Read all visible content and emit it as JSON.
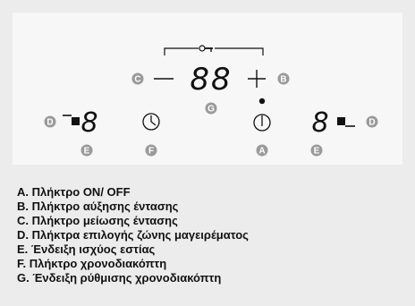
{
  "badges": {
    "A": "A",
    "B": "B",
    "C": "C",
    "D": "D",
    "E": "E",
    "F": "F",
    "G": "G"
  },
  "display": {
    "timer_digits": "88",
    "zone_left_digit": "8",
    "zone_right_digit": "8"
  },
  "symbols": {
    "minus": "—",
    "plus": "+"
  },
  "icons": {
    "lock": "key-lock-icon",
    "power": "power-icon",
    "timer": "clock-icon",
    "zone_select": "zone-select-icon"
  },
  "legend": [
    {
      "text": "A. Πλήκτρο ON/ OFF"
    },
    {
      "text": "B. Πλήκτρο αύξησης έντασης"
    },
    {
      "text": "C. Πλήκτρο μείωσης έντασης"
    },
    {
      "text": "D. Πλήκτρα επιλογής ζώνης μαγειρέματος"
    },
    {
      "text": "E. Ένδειξη ισχύος εστίας"
    },
    {
      "text": "F. Πλήκτρο χρονοδιακόπτη"
    },
    {
      "text": "G. Ένδειξη ρύθμισης χρονοδιακόπτη"
    }
  ],
  "colors": {
    "badge": "#9a9a9a",
    "panel": "#f7f7f7",
    "background": "#ececec"
  }
}
